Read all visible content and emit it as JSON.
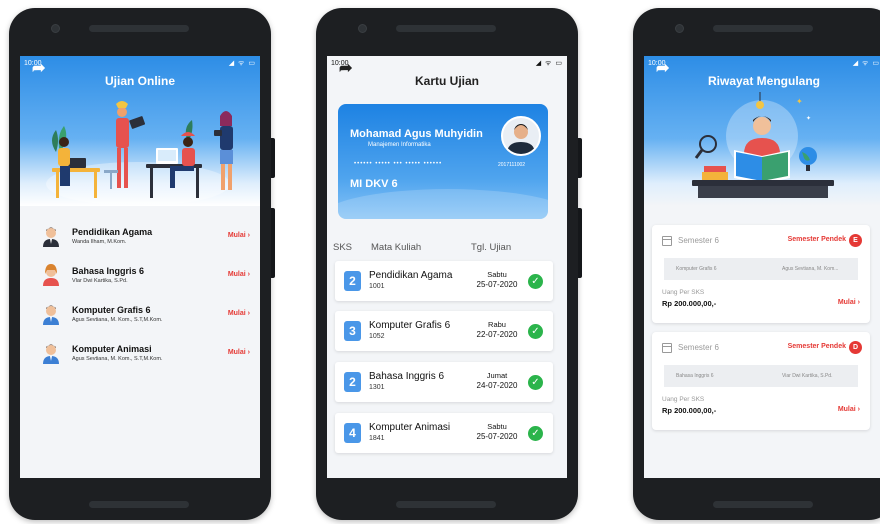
{
  "status_time": "10:00",
  "status_icons": "◢ ᯤ ▭",
  "back_glyph": "➦",
  "screen1": {
    "title": "Ujian Online",
    "items": [
      {
        "title": "Pendidikan Agama",
        "lecturer": "Wanda Ilham, M.Kom.",
        "action": "Mulai ›"
      },
      {
        "title": "Bahasa Inggris 6",
        "lecturer": "Vlar Dwi Kartika, S.Pd.",
        "action": "Mulai ›"
      },
      {
        "title": "Komputer Grafis 6",
        "lecturer": "Agus Sevtiana, M. Kom., S.T,M.Kom.",
        "action": "Mulai ›"
      },
      {
        "title": "Komputer Animasi",
        "lecturer": "Agus Sevtiana, M. Kom., S.T,M.Kom.",
        "action": "Mulai ›"
      }
    ]
  },
  "screen2": {
    "title": "Kartu Ujian",
    "card": {
      "name": "Mohamad Agus Muhyidin",
      "program": "Manajemen Informatika",
      "masked": "•••••• ••••• ••• ••••• ••••••",
      "nim": "2017111002",
      "class": "MI DKV 6"
    },
    "headers": {
      "sks": "SKS",
      "course": "Mata Kuliah",
      "date": "Tgl. Ujian"
    },
    "rows": [
      {
        "sks": "2",
        "course": "Pendidikan Agama",
        "code": "1001",
        "day": "Sabtu",
        "date": "25-07-2020",
        "check": "✓"
      },
      {
        "sks": "3",
        "course": "Komputer Grafis 6",
        "code": "1052",
        "day": "Rabu",
        "date": "22-07-2020",
        "check": "✓"
      },
      {
        "sks": "2",
        "course": "Bahasa Inggris 6",
        "code": "1301",
        "day": "Jumat",
        "date": "24-07-2020",
        "check": "✓"
      },
      {
        "sks": "4",
        "course": "Komputer Animasi",
        "code": "1841",
        "day": "Sabtu",
        "date": "25-07-2020",
        "check": "✓"
      }
    ]
  },
  "screen3": {
    "title": "Riwayat Mengulang",
    "cards": [
      {
        "semester": "Semester 6",
        "type": "Semester Pendek",
        "badge": "E",
        "course": "Komputer Grafis 6",
        "lecturer": "Agus Sevtiana, M. Kom...",
        "fee_label": "Uang Per SKS",
        "fee": "Rp 200.000,00,-",
        "action": "Mulai ›"
      },
      {
        "semester": "Semester 6",
        "type": "Semester Pendek",
        "badge": "D",
        "course": "Bahasa Inggris 6",
        "lecturer": "Viar Dwi Kartika, S.Pd.",
        "fee_label": "Uang Per SKS",
        "fee": "Rp 200.000,00,-",
        "action": "Mulai ›"
      }
    ]
  },
  "colors": {
    "accent": "#2d8de6",
    "danger": "#e53935",
    "success": "#2bb44b",
    "sks_badge": "#4a97e8"
  }
}
